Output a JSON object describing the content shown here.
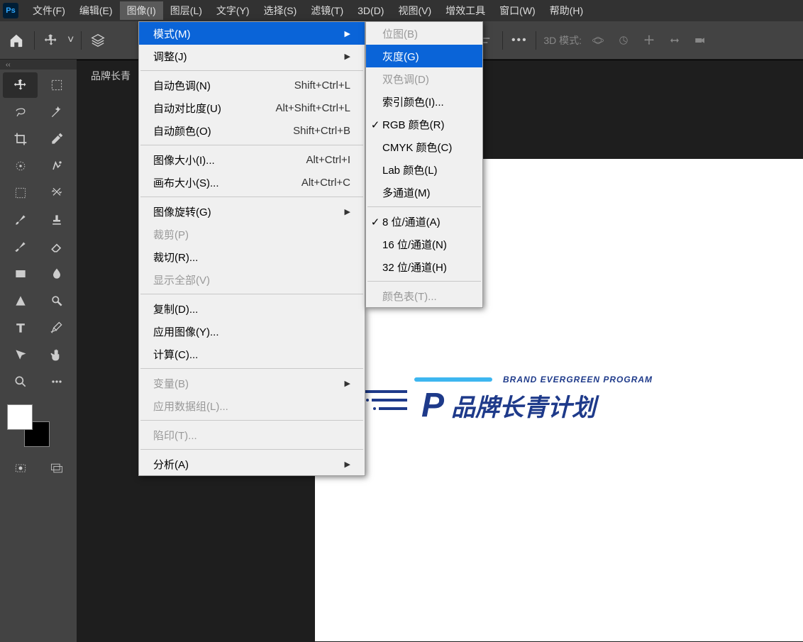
{
  "app": {
    "logo": "Ps"
  },
  "menubar": {
    "items": [
      "文件(F)",
      "编辑(E)",
      "图像(I)",
      "图层(L)",
      "文字(Y)",
      "选择(S)",
      "滤镜(T)",
      "3D(D)",
      "视图(V)",
      "增效工具",
      "窗口(W)",
      "帮助(H)"
    ],
    "active_index": 2
  },
  "optbar": {
    "mode_label": "3D 模式:"
  },
  "document": {
    "tab_title": "品牌长青"
  },
  "canvas_logo": {
    "top_en": "BRAND EVERGREEN PROGRAM",
    "main_cn": "品牌长青计划",
    "mark": "P"
  },
  "dropdown_image": {
    "groups": [
      {
        "items": [
          {
            "label": "模式(M)",
            "shortcut": "",
            "submenu": true,
            "highlighted": true
          },
          {
            "label": "调整(J)",
            "shortcut": "",
            "submenu": true
          }
        ]
      },
      {
        "items": [
          {
            "label": "自动色调(N)",
            "shortcut": "Shift+Ctrl+L"
          },
          {
            "label": "自动对比度(U)",
            "shortcut": "Alt+Shift+Ctrl+L"
          },
          {
            "label": "自动颜色(O)",
            "shortcut": "Shift+Ctrl+B"
          }
        ]
      },
      {
        "items": [
          {
            "label": "图像大小(I)...",
            "shortcut": "Alt+Ctrl+I"
          },
          {
            "label": "画布大小(S)...",
            "shortcut": "Alt+Ctrl+C"
          }
        ]
      },
      {
        "items": [
          {
            "label": "图像旋转(G)",
            "shortcut": "",
            "submenu": true
          },
          {
            "label": "裁剪(P)",
            "shortcut": "",
            "disabled": true
          },
          {
            "label": "裁切(R)...",
            "shortcut": ""
          },
          {
            "label": "显示全部(V)",
            "shortcut": "",
            "disabled": true
          }
        ]
      },
      {
        "items": [
          {
            "label": "复制(D)...",
            "shortcut": ""
          },
          {
            "label": "应用图像(Y)...",
            "shortcut": ""
          },
          {
            "label": "计算(C)...",
            "shortcut": ""
          }
        ]
      },
      {
        "items": [
          {
            "label": "变量(B)",
            "shortcut": "",
            "submenu": true,
            "disabled": true
          },
          {
            "label": "应用数据组(L)...",
            "shortcut": "",
            "disabled": true
          }
        ]
      },
      {
        "items": [
          {
            "label": "陷印(T)...",
            "shortcut": "",
            "disabled": true
          }
        ]
      },
      {
        "items": [
          {
            "label": "分析(A)",
            "shortcut": "",
            "submenu": true
          }
        ]
      }
    ]
  },
  "dropdown_mode": {
    "groups": [
      {
        "items": [
          {
            "label": "位图(B)",
            "disabled": true
          },
          {
            "label": "灰度(G)",
            "highlighted": true
          },
          {
            "label": "双色调(D)",
            "disabled": true
          },
          {
            "label": "索引颜色(I)..."
          },
          {
            "label": "RGB 颜色(R)",
            "checked": true
          },
          {
            "label": "CMYK 颜色(C)"
          },
          {
            "label": "Lab 颜色(L)"
          },
          {
            "label": "多通道(M)"
          }
        ]
      },
      {
        "items": [
          {
            "label": "8 位/通道(A)",
            "checked": true
          },
          {
            "label": "16 位/通道(N)"
          },
          {
            "label": "32 位/通道(H)"
          }
        ]
      },
      {
        "items": [
          {
            "label": "颜色表(T)...",
            "disabled": true
          }
        ]
      }
    ]
  },
  "tools": [
    {
      "name": "move"
    },
    {
      "name": "marquee"
    },
    {
      "name": "lasso"
    },
    {
      "name": "wand"
    },
    {
      "name": "crop"
    },
    {
      "name": "eyedropper"
    },
    {
      "name": "patch"
    },
    {
      "name": "spot-heal"
    },
    {
      "name": "frame"
    },
    {
      "name": "swap"
    },
    {
      "name": "brush"
    },
    {
      "name": "stamp"
    },
    {
      "name": "history"
    },
    {
      "name": "eraser"
    },
    {
      "name": "gradient"
    },
    {
      "name": "blur"
    },
    {
      "name": "pen-triangle"
    },
    {
      "name": "dodge"
    },
    {
      "name": "type"
    },
    {
      "name": "pen"
    },
    {
      "name": "path"
    },
    {
      "name": "hand"
    },
    {
      "name": "zoom"
    },
    {
      "name": "more"
    }
  ]
}
